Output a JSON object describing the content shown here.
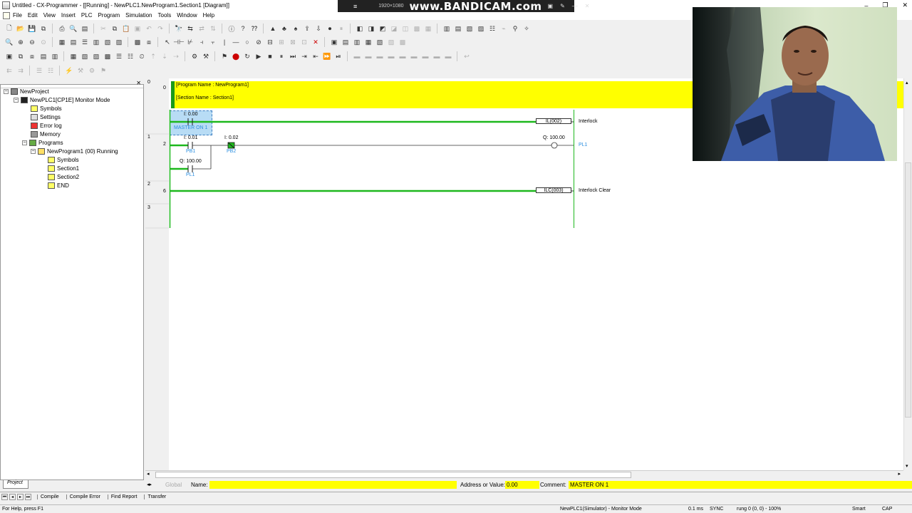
{
  "window": {
    "title": "Untitled - CX-Programmer - [[Running] - NewPLC1.NewProgram1.Section1 [Diagram]]",
    "controls": [
      "–",
      "❐",
      "✕"
    ]
  },
  "overlay": {
    "menu_glyph": "≡",
    "resolution": "1920×1080",
    "logo": "www.BANDICAM.com",
    "icons": [
      "▣",
      "✎",
      "—",
      "✕"
    ]
  },
  "menu": [
    "File",
    "Edit",
    "View",
    "Insert",
    "PLC",
    "Program",
    "Simulation",
    "Tools",
    "Window",
    "Help"
  ],
  "tree": {
    "nodes": [
      {
        "label": "NewProject"
      },
      {
        "label": "NewPLC1[CP1E] Monitor Mode"
      },
      {
        "label": "Symbols"
      },
      {
        "label": "Settings"
      },
      {
        "label": "Error log"
      },
      {
        "label": "Memory"
      },
      {
        "label": "Programs"
      },
      {
        "label": "NewProgram1 (00) Running"
      },
      {
        "label": "Symbols"
      },
      {
        "label": "Section1"
      },
      {
        "label": "Section2"
      },
      {
        "label": "END"
      }
    ],
    "tab_label": "Project",
    "close": "✕"
  },
  "ladder": {
    "program_comment": "[Program Name : NewProgram1]",
    "section_comment": "[Section Name : Section1]",
    "rung_indexes": [
      "0",
      "1",
      "2",
      "3"
    ],
    "step_numbers": [
      "0",
      "2",
      "6"
    ],
    "rung0": {
      "contact_address": "I: 0.00",
      "contact_comment": "MASTER ON 1",
      "instruction": "IL(002)",
      "instruction_comment": "Interlock"
    },
    "rung1": {
      "contact1_address": "I: 0.01",
      "contact1_comment": "PB1",
      "contact2_address": "I: 0.02",
      "contact2_comment": "PB2",
      "coil_address": "Q: 100.00",
      "coil_comment": "PL1",
      "branch_address": "Q: 100.00",
      "branch_comment": "PL1"
    },
    "rung2": {
      "instruction": "ILC(003)",
      "instruction_comment": "Interlock Clear"
    },
    "colors": {
      "powerflow": "#1db81d",
      "comment_band": "#ffff00",
      "selection": "#b8dcf5"
    }
  },
  "namebar": {
    "global_label": "Global",
    "name_label": "Name:",
    "name_value": "",
    "address_label": "Address or Value:",
    "address_value": "0.00",
    "comment_label": "Comment:",
    "comment_value": "MASTER ON 1"
  },
  "output_tabs": [
    "Compile",
    "Compile Error",
    "Find Report",
    "Transfer"
  ],
  "status": {
    "help": "For Help, press F1",
    "plc": "NewPLC1(Simulator) - Monitor Mode",
    "cycle": "0.1 ms",
    "sync": "SYNC",
    "position": "rung 0 (0, 0) - 100%",
    "mode": "Smart",
    "caps": "CAP"
  }
}
